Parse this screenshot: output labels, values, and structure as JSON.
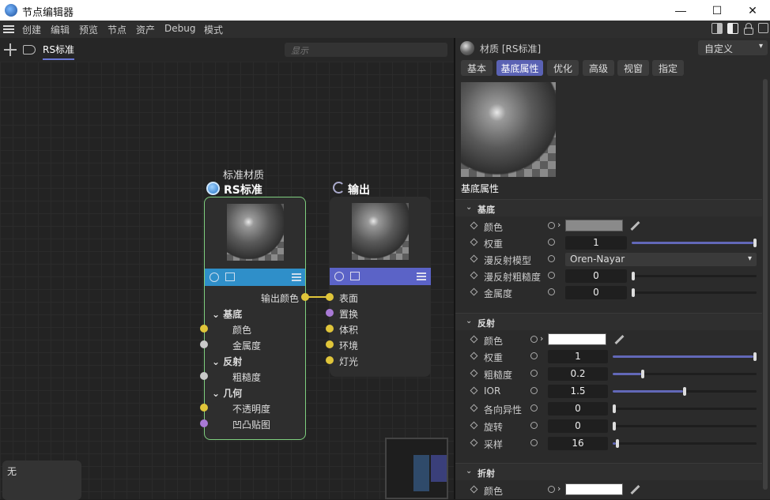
{
  "window": {
    "title": "节点编辑器",
    "minimize": "—",
    "maximize": "☐",
    "close": "✕"
  },
  "menu": {
    "items": [
      "创建",
      "编辑",
      "预览",
      "节点",
      "资产",
      "Debug",
      "模式"
    ]
  },
  "graph": {
    "tab": "RS标准",
    "search_placeholder": "显示",
    "null_panel": "无",
    "node_rs": {
      "caption": "标准材质",
      "title": "RS标准",
      "output_port": "输出颜色",
      "groups": [
        {
          "label": "基底",
          "ports": [
            "颜色",
            "金属度"
          ]
        },
        {
          "label": "反射",
          "ports": [
            "粗糙度"
          ]
        },
        {
          "label": "几何",
          "ports": [
            "不透明度",
            "凹凸贴图"
          ]
        }
      ]
    },
    "node_output": {
      "title": "输出",
      "ports": [
        "表面",
        "置换",
        "体积",
        "环境",
        "灯光"
      ]
    },
    "colors": {
      "accent": "#6a78d6",
      "rs_bar": "#2f8fc9",
      "output_bar": "#5b63c7",
      "yellow_port": "#e0c53a",
      "purple_port": "#a97ad6",
      "grey_port": "#c9c9c9",
      "node_border": "#7fcf7f"
    }
  },
  "attributes": {
    "header_title": "材质 [RS标准]",
    "mode": "自定义",
    "tabs": [
      "基本",
      "基底属性",
      "优化",
      "高级",
      "视窗",
      "指定"
    ],
    "active_tab": "基底属性",
    "section_title": "基底属性",
    "base": {
      "label": "基底",
      "rows": [
        {
          "label": "颜色",
          "type": "color",
          "color": "#8a8a8a"
        },
        {
          "label": "权重",
          "type": "number",
          "value": "1",
          "level": 1.0
        },
        {
          "label": "漫反射模型",
          "type": "dropdown",
          "value": "Oren-Nayar"
        },
        {
          "label": "漫反射粗糙度",
          "type": "number",
          "value": "0",
          "level": 0.0
        },
        {
          "label": "金属度",
          "type": "number",
          "value": "0",
          "level": 0.0
        }
      ]
    },
    "reflection": {
      "label": "反射",
      "rows": [
        {
          "label": "颜色",
          "type": "color",
          "color": "#ffffff"
        },
        {
          "label": "权重",
          "type": "number",
          "value": "1",
          "level": 1.0
        },
        {
          "label": "粗糙度",
          "type": "number",
          "value": "0.2",
          "level": 0.2
        },
        {
          "label": "IOR",
          "type": "number",
          "value": "1.5",
          "level": 0.5
        },
        {
          "label": "各向异性",
          "type": "number",
          "value": "0",
          "level": 0.0
        },
        {
          "label": "旋转",
          "type": "number",
          "value": "0",
          "level": 0.0
        },
        {
          "label": "采样",
          "type": "number",
          "value": "16",
          "level": 0.02
        }
      ]
    },
    "refraction": {
      "label": "折射",
      "rows": [
        {
          "label": "颜色",
          "type": "color",
          "color": "#ffffff"
        }
      ]
    }
  }
}
